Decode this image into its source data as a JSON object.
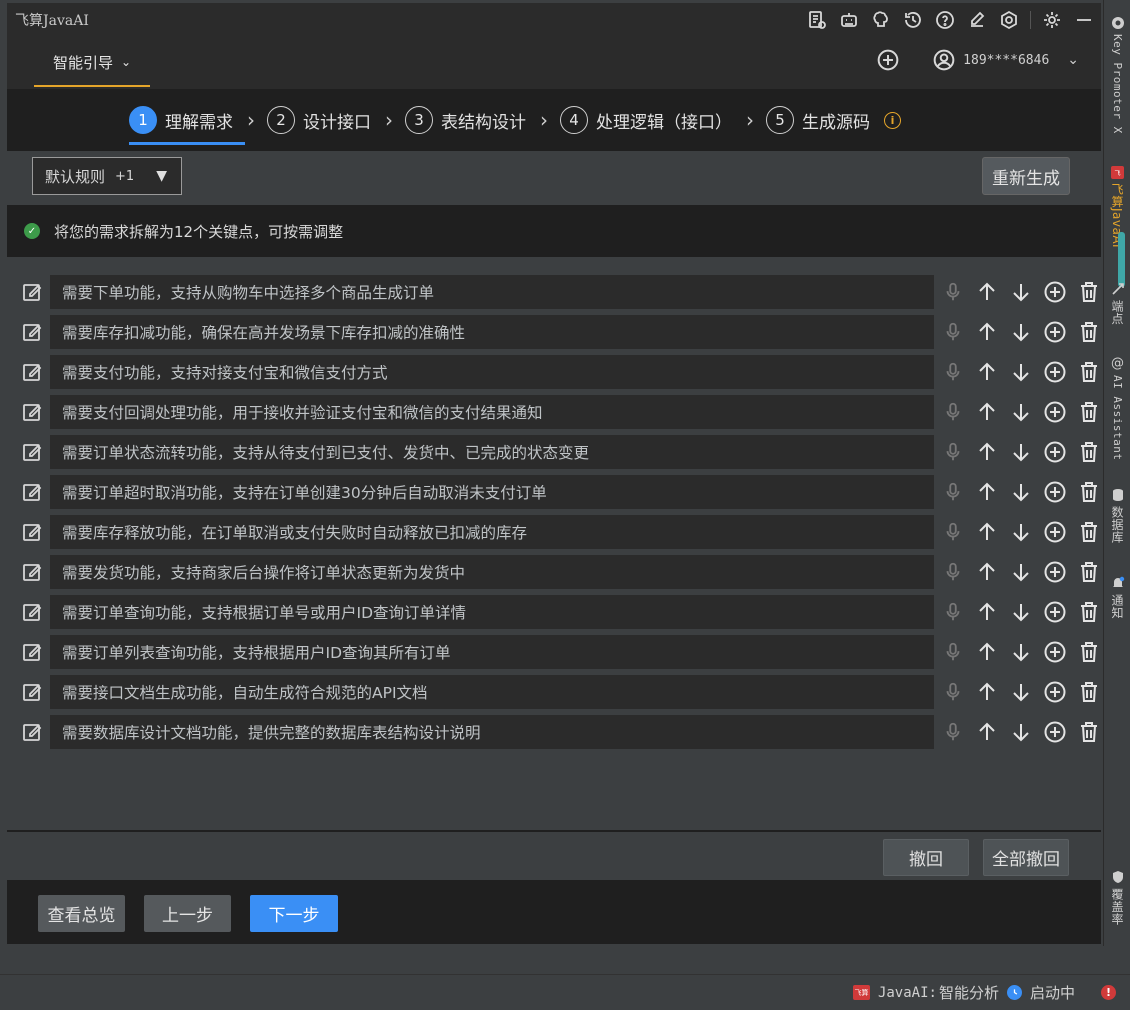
{
  "window": {
    "title": "飞算JavaAI"
  },
  "title_icons": [
    "document-settings-icon",
    "robot-icon",
    "brain-icon",
    "history-icon",
    "help-icon",
    "edit-icon",
    "hexagon-icon",
    "gear-icon",
    "minimize-icon"
  ],
  "header": {
    "guide_tab": "智能引导",
    "user_phone": "189****6846"
  },
  "steps": [
    {
      "num": "1",
      "label": "理解需求",
      "active": true
    },
    {
      "num": "2",
      "label": "设计接口",
      "active": false
    },
    {
      "num": "3",
      "label": "表结构设计",
      "active": false
    },
    {
      "num": "4",
      "label": "处理逻辑（接口）",
      "active": false
    },
    {
      "num": "5",
      "label": "生成源码",
      "active": false
    }
  ],
  "rules": {
    "selected": "默认规则",
    "extra": "+1",
    "regenerate_label": "重新生成"
  },
  "notice": "将您的需求拆解为12个关键点，可按需调整",
  "requirements": [
    "需要下单功能，支持从购物车中选择多个商品生成订单",
    "需要库存扣减功能，确保在高并发场景下库存扣减的准确性",
    "需要支付功能，支持对接支付宝和微信支付方式",
    "需要支付回调处理功能，用于接收并验证支付宝和微信的支付结果通知",
    "需要订单状态流转功能，支持从待支付到已支付、发货中、已完成的状态变更",
    "需要订单超时取消功能，支持在订单创建30分钟后自动取消未支付订单",
    "需要库存释放功能，在订单取消或支付失败时自动释放已扣减的库存",
    "需要发货功能，支持商家后台操作将订单状态更新为发货中",
    "需要订单查询功能，支持根据订单号或用户ID查询订单详情",
    "需要订单列表查询功能，支持根据用户ID查询其所有订单",
    "需要接口文档生成功能，自动生成符合规范的API文档",
    "需要数据库设计文档功能，提供完整的数据库表结构设计说明"
  ],
  "undo": {
    "undo_label": "撤回",
    "undo_all_label": "全部撤回"
  },
  "footer": {
    "overview_label": "查看总览",
    "prev_label": "上一步",
    "next_label": "下一步"
  },
  "right_bar": {
    "key_promoter": "Key Promoter X",
    "javaai": "飞算JavaAI",
    "endpoints": "端点",
    "ai_assistant": "AI Assistant",
    "database": "数据库",
    "notifications": "通知",
    "coverage": "覆盖率"
  },
  "status": {
    "app_logo": "飞算",
    "label": "JavaAI:",
    "analysis": "智能分析",
    "starting": "启动中"
  },
  "colors": {
    "accent_blue": "#3a8ff5",
    "accent_orange": "#e5a52a",
    "success_green": "#3d9b4a",
    "error_red": "#d13a3a"
  }
}
